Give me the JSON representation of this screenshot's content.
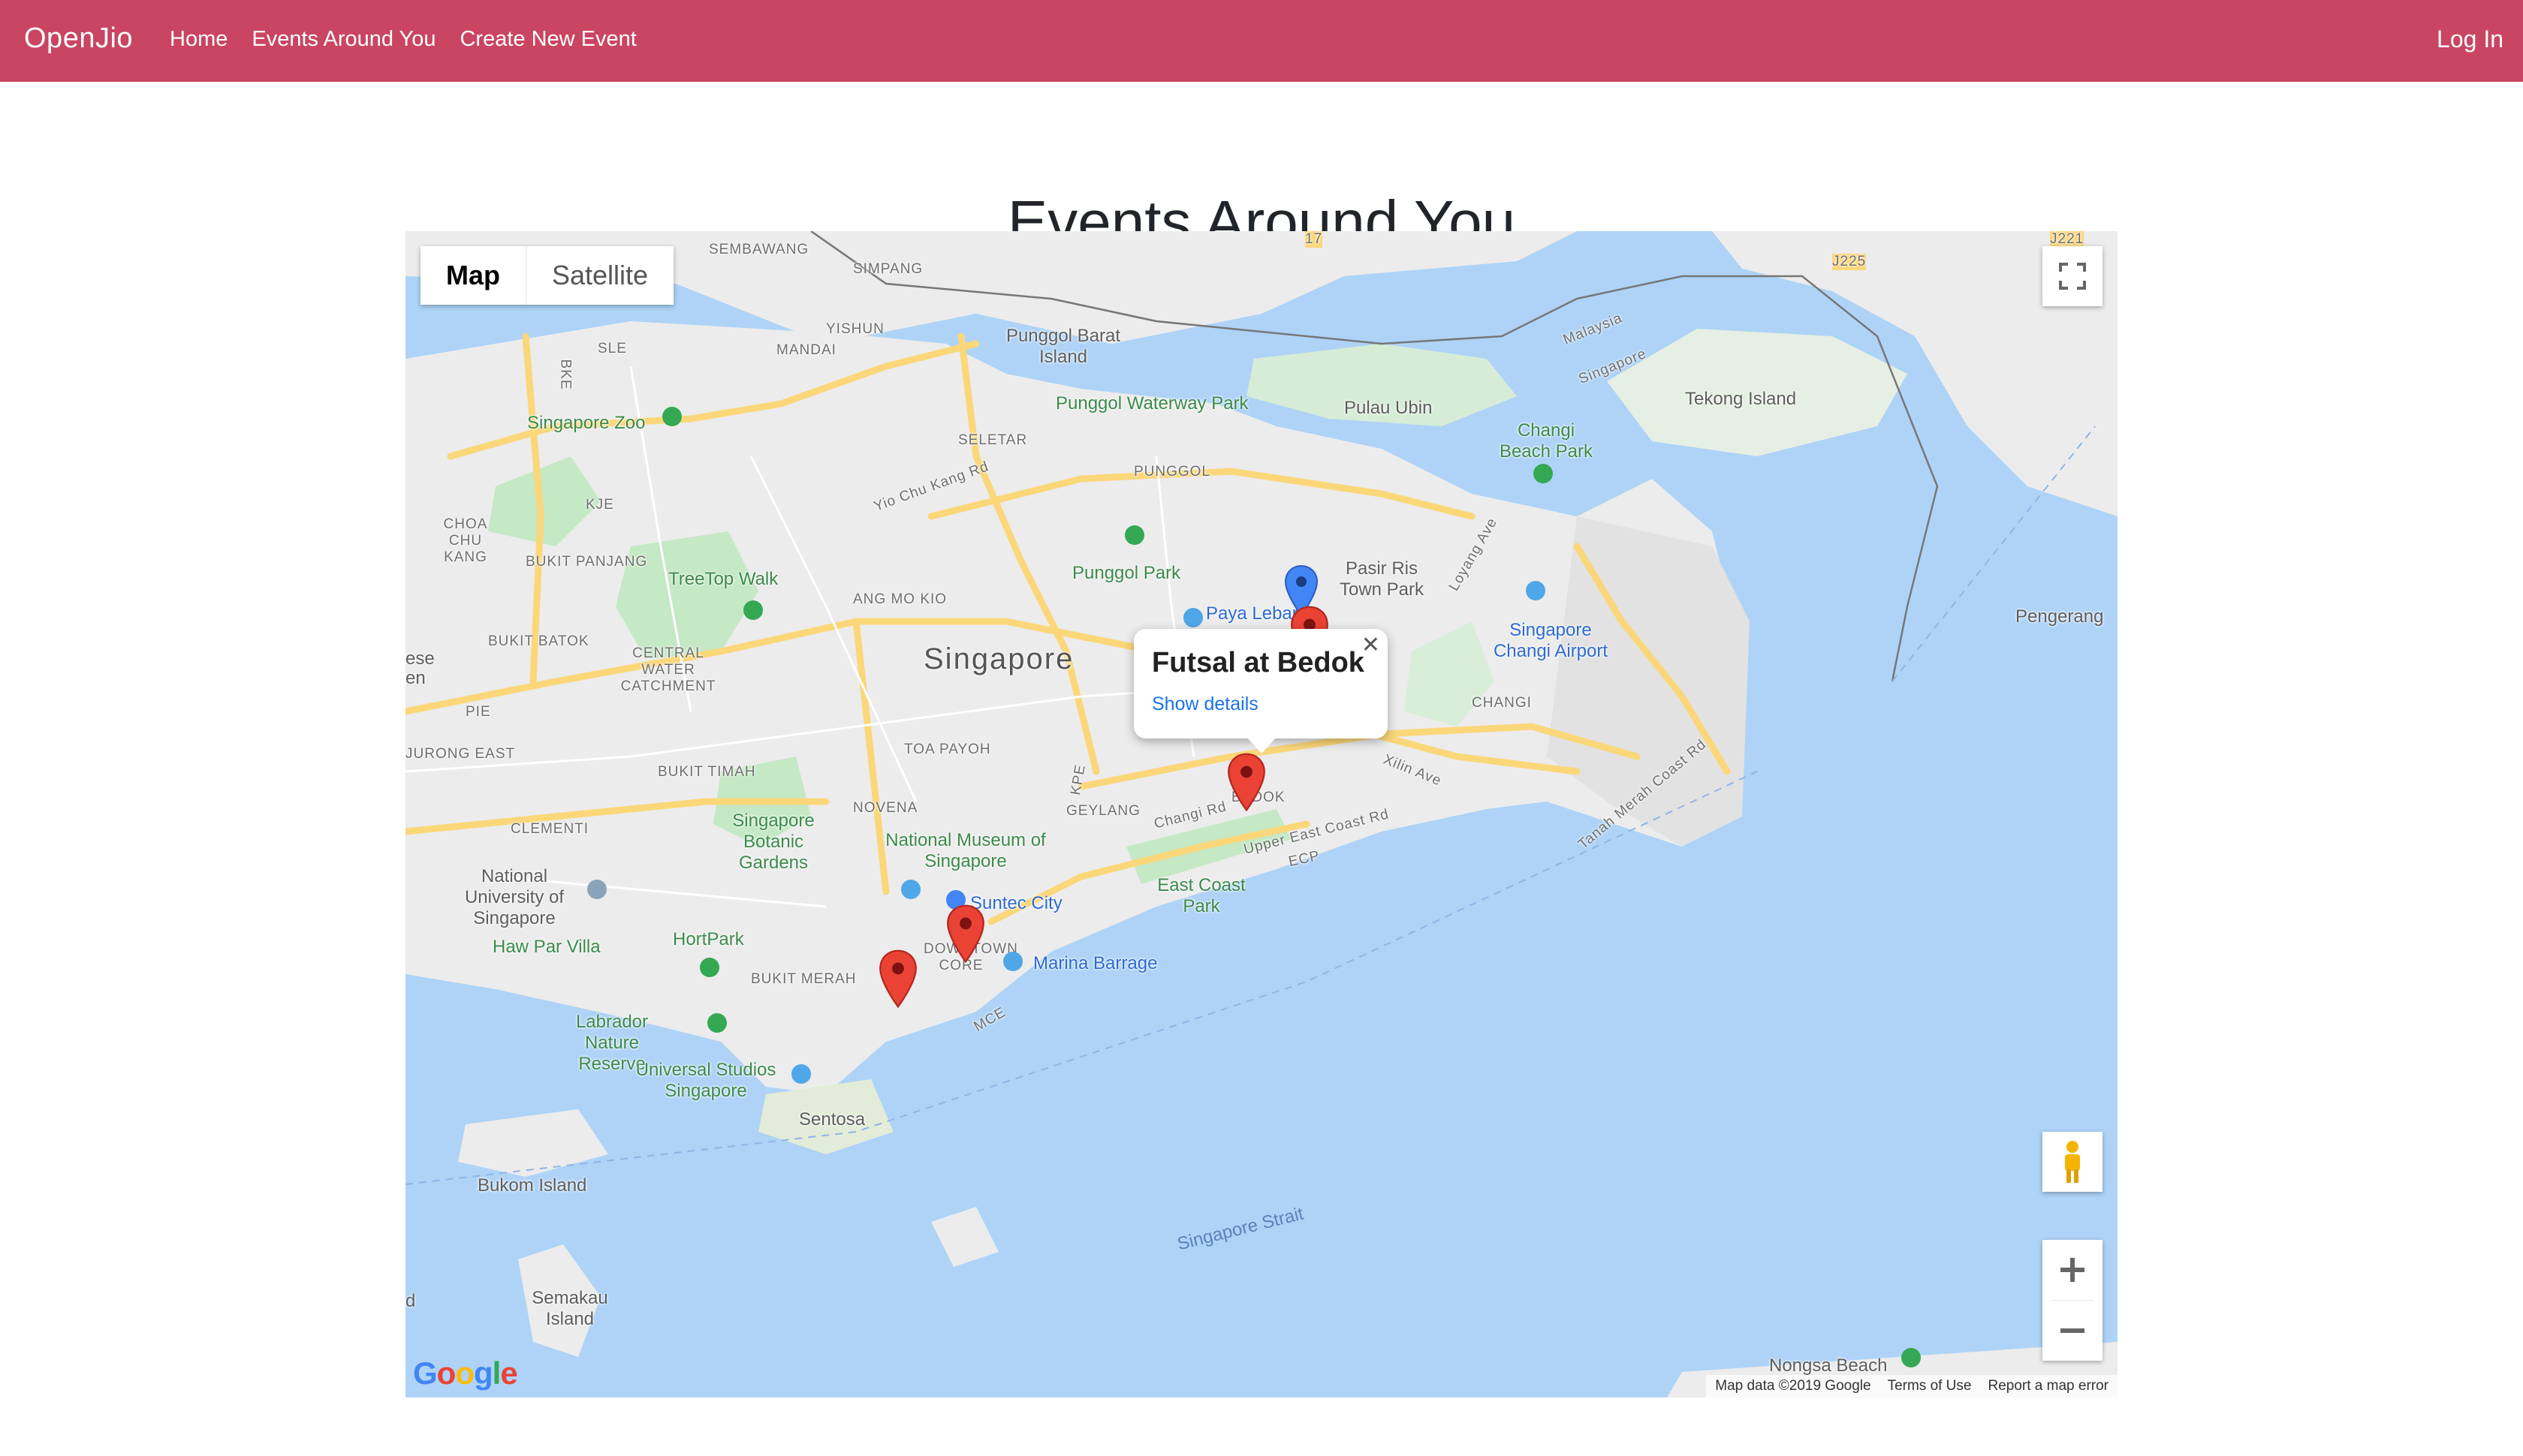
{
  "navbar": {
    "brand": "OpenJio",
    "links": [
      "Home",
      "Events Around You",
      "Create New Event"
    ],
    "login": "Log In",
    "color": "#c94562"
  },
  "page": {
    "title": "Events Around You"
  },
  "map": {
    "type_buttons": {
      "map": "Map",
      "satellite": "Satellite",
      "selected": "Map"
    },
    "labels": {
      "sembawang": "SEMBAWANG",
      "simpang": "SIMPANG",
      "yishun": "YISHUN",
      "mandai": "MANDAI",
      "punggol_barat": "Punggol Barat Island",
      "punggol_waterway": "Punggol Waterway Park",
      "pulau_ubin": "Pulau Ubin",
      "changi_beach": "Changi Beach Park",
      "tekong": "Tekong Island",
      "malaysia": "Malaysia",
      "singapore_border": "Singapore",
      "zoo": "Singapore Zoo",
      "seletar": "SELETAR",
      "punggol": "PUNGGOL",
      "yio_chu_kang": "Yio Chu Kang Rd",
      "choa_chu_kang": "CHOA CHU KANG",
      "bukit_panjang": "BUKIT PANJANG",
      "treetop": "TreeTop Walk",
      "ang_mo_kio": "ANG MO KIO",
      "punggol_park": "Punggol Park",
      "pasir_ris": "Pasir Ris Town Park",
      "paya_lebar": "Paya Lebar",
      "changi_airport": "Singapore Changi Airport",
      "pengerang": "Pengerang",
      "bukit_batok": "BUKIT BATOK",
      "central_water": "CENTRAL WATER CATCHMENT",
      "singapore": "Singapore",
      "changi": "CHANGI",
      "toa_payoh": "TOA PAYOH",
      "jurong_east": "JURONG EAST",
      "bukit_timah": "BUKIT TIMAH",
      "novena": "NOVENA",
      "geylang": "GEYLANG",
      "bedok": "BEDOK",
      "xilin": "Xilin Ave",
      "clementi": "CLEMENTI",
      "botanic": "Singapore Botanic Gardens",
      "national_museum": "National Museum of Singapore",
      "changi_rd": "Changi Rd",
      "upper_east_coast": "Upper East Coast Rd",
      "tanah_merah": "Tanah Merah Coast Rd",
      "nus": "National University of Singapore",
      "east_coast_park": "East Coast Park",
      "suntec": "Suntec City",
      "haw_par": "Haw Par Villa",
      "hortpark": "HortPark",
      "marina_barrage": "Marina Barrage",
      "bukit_merah": "BUKIT MERAH",
      "downtown": "DOWNTOWN CORE",
      "labrador": "Labrador Nature Reserve",
      "universal": "Universal Studios Singapore",
      "sentosa": "Sentosa",
      "bukom": "Bukom Island",
      "strait": "Singapore Strait",
      "semakau": "Semakau Island",
      "nongsa": "Nongsa Beach",
      "pie": "PIE",
      "sle": "SLE",
      "bke": "BKE",
      "kje": "KJE",
      "kpe": "KPE",
      "ecp": "ECP",
      "mce": "MCE",
      "loyang": "Loyang Ave",
      "j225": "J225",
      "j221": "J221",
      "seventeen": "17",
      "ese": "ese",
      "en": "en",
      "d": "d"
    },
    "info_window": {
      "title": "Futsal at Bedok",
      "link": "Show details"
    },
    "markers": [
      {
        "name": "bedok",
        "color": "#ea4335"
      },
      {
        "name": "downtown",
        "color": "#ea4335"
      },
      {
        "name": "bukit-merah",
        "color": "#ea4335"
      },
      {
        "name": "pasir-ris",
        "color": "#ea4335"
      },
      {
        "name": "current-location",
        "color": "#4285f4"
      }
    ],
    "footer": {
      "data": "Map data ©2019 Google",
      "terms": "Terms of Use",
      "report": "Report a map error"
    },
    "google_logo": "Google",
    "colors": {
      "water": "#aed3f7",
      "land": "#ececec",
      "park": "#c5e8c5",
      "road": "#fbd77a"
    }
  }
}
